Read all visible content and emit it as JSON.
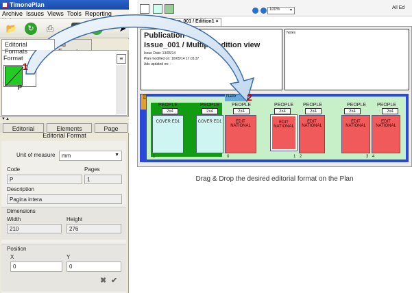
{
  "app": {
    "title": "TimonePlan"
  },
  "menu": [
    "Archive",
    "Issues",
    "Views",
    "Tools",
    "Reporting",
    "Help"
  ],
  "format_tabs": [
    "Editorial Formats",
    "Ad Formats"
  ],
  "format_panel": {
    "label": "Format",
    "thumb_label": "P"
  },
  "bottom_tabs": [
    "Editorial",
    "Elements",
    "Page"
  ],
  "properties": {
    "title": "Editorial Format",
    "unit_label": "Unit of measure",
    "unit_value": "mm",
    "code_label": "Code",
    "code_value": "P",
    "pages_label": "Pages",
    "pages_value": "1",
    "desc_label": "Description",
    "desc_value": "Pagina intera",
    "dims_label": "Dimensions",
    "width_label": "Width",
    "width_value": "210",
    "height_label": "Height",
    "height_value": "276",
    "pos_label": "Position",
    "x_label": "X",
    "x_value": "0",
    "y_label": "Y",
    "y_value": "0"
  },
  "right_toolbar": {
    "zoom": "100%",
    "right_text": "All Ed"
  },
  "doc_tab": "Publication Issue_001 / Edition1",
  "publication": {
    "heading": "Publication",
    "subheading": "Issue_001 / Multiple edition view",
    "issue_date": "Issue Date: 13/05/14",
    "plan_modified": "Plan modified on: 16/05/14 17.03.37",
    "ads_updated": "Ads updated on: -"
  },
  "notes_label": "Notes",
  "plan": {
    "side_label": "Edi",
    "national_label": "Natio",
    "columns": [
      {
        "section": "PEOPLE",
        "size": "2x4",
        "text": "COVER ED1"
      },
      {
        "section": "PEOPLE",
        "size": "2x4",
        "text": "COVER ED1"
      },
      {
        "section": "PEOPLE",
        "size": "2x4",
        "text": "EDIT NATIONAL"
      },
      {
        "section": "PEOPLE",
        "size": "2x4",
        "text": "EDIT NATIONAL"
      },
      {
        "section": "PEOPLE",
        "size": "2x4",
        "text": "EDIT NATIONAL"
      },
      {
        "section": "PEOPLE",
        "size": "2x4",
        "text": "EDIT NATIONAL"
      },
      {
        "section": "PEOPLE",
        "size": "2x4",
        "text": "EDIT NATIONAL"
      }
    ],
    "page_numbers": [
      "1",
      "0",
      "1",
      "2",
      "3",
      "4"
    ]
  },
  "caption": "Drag & Drop the desired editorial format on the Plan",
  "markers": {
    "one": "1",
    "two": "2"
  },
  "colors": {
    "plan_blue": "#2a49d8",
    "cover_cyan": "#cff5f3",
    "edit_red": "#f05a5a",
    "format_green": "#22cc22"
  }
}
